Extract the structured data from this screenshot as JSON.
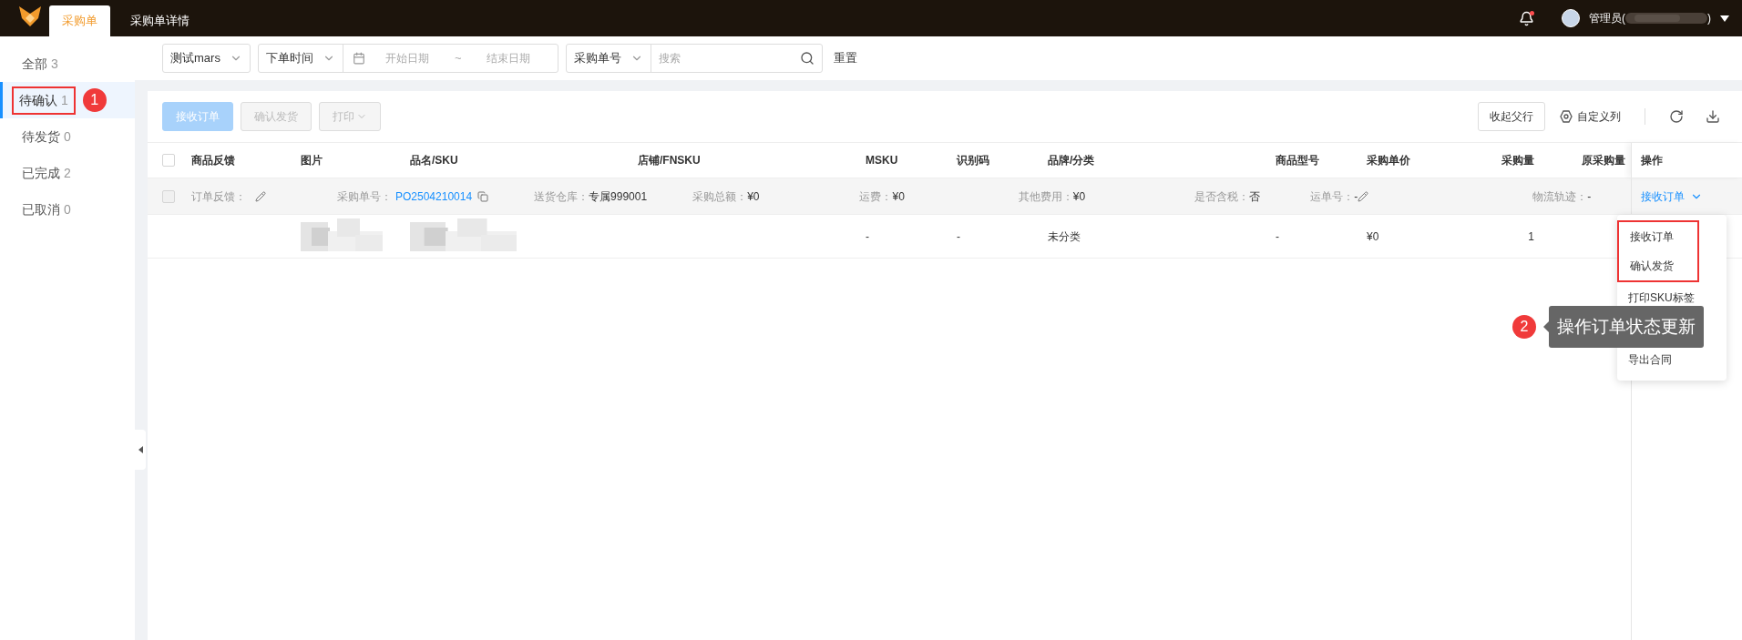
{
  "top_bar": {
    "tabs": [
      {
        "label": "采购单",
        "selected": true
      },
      {
        "label": "采购单详情",
        "selected": false
      }
    ],
    "notification": {
      "unread": true
    },
    "user": {
      "name_start": "管理员(",
      "name_end": ")"
    }
  },
  "sidebar": {
    "items": [
      {
        "label": "全部",
        "count": "3",
        "selected": false,
        "highlighted": false
      },
      {
        "label": "待确认",
        "count": "1",
        "selected": true,
        "highlighted": true
      },
      {
        "label": "待发货",
        "count": "0",
        "selected": false,
        "highlighted": false
      },
      {
        "label": "已完成",
        "count": "2",
        "selected": false,
        "highlighted": false
      },
      {
        "label": "已取消",
        "count": "0",
        "selected": false,
        "highlighted": false
      }
    ],
    "marker": "1"
  },
  "filters": {
    "store_select": "测试mars",
    "time_select": "下单时间",
    "start_placeholder": "开始日期",
    "separator": "~",
    "end_placeholder": "结束日期",
    "search_select": "采购单号",
    "search_placeholder": "搜索",
    "reset": "重置"
  },
  "toolbar": {
    "buttons": [
      {
        "label": "接收订单",
        "kind": "primary",
        "disabled": true
      },
      {
        "label": "确认发货",
        "kind": "default",
        "disabled": true
      },
      {
        "label": "打印",
        "kind": "dropdown",
        "disabled": true
      }
    ],
    "collapse": "收起父行",
    "columns": "自定义列"
  },
  "table": {
    "select_all_checked": false,
    "columns": [
      "商品反馈",
      "图片",
      "品名/SKU",
      "店铺/FNSKU",
      "MSKU",
      "识别码",
      "品牌/分类",
      "商品型号",
      "采购单价",
      "采购量",
      "原采购量",
      "操作"
    ],
    "group_row": {
      "checked": false,
      "feedback": "订单反馈：",
      "order_label": "采购单号：",
      "order_no": "PO2504210014",
      "warehouse_label": "送货仓库：",
      "warehouse": "专属999001",
      "total_label": "采购总额：",
      "total": "¥0",
      "freight_label": "运费：",
      "freight": "¥0",
      "other_label": "其他费用：",
      "other": "¥0",
      "tax_label": "是否含税：",
      "tax": "否",
      "waybill_label": "运单号：",
      "waybill": "-",
      "logistics_label": "物流轨迹：",
      "logistics": "-",
      "action": "接收订单"
    },
    "rows": [
      {
        "msku": "-",
        "code": "-",
        "brand": "未分类",
        "model": "-",
        "price": "¥0",
        "qty": "1"
      }
    ]
  },
  "action_menu": {
    "items": [
      {
        "label": "接收订单",
        "highlighted": true
      },
      {
        "label": "确认发货",
        "highlighted": true
      },
      {
        "label": "打印SKU标签",
        "highlighted": false
      },
      {
        "label": "导出合同",
        "highlighted": false
      }
    ]
  },
  "note": {
    "marker": "2",
    "text": "操作订单状态更新"
  }
}
